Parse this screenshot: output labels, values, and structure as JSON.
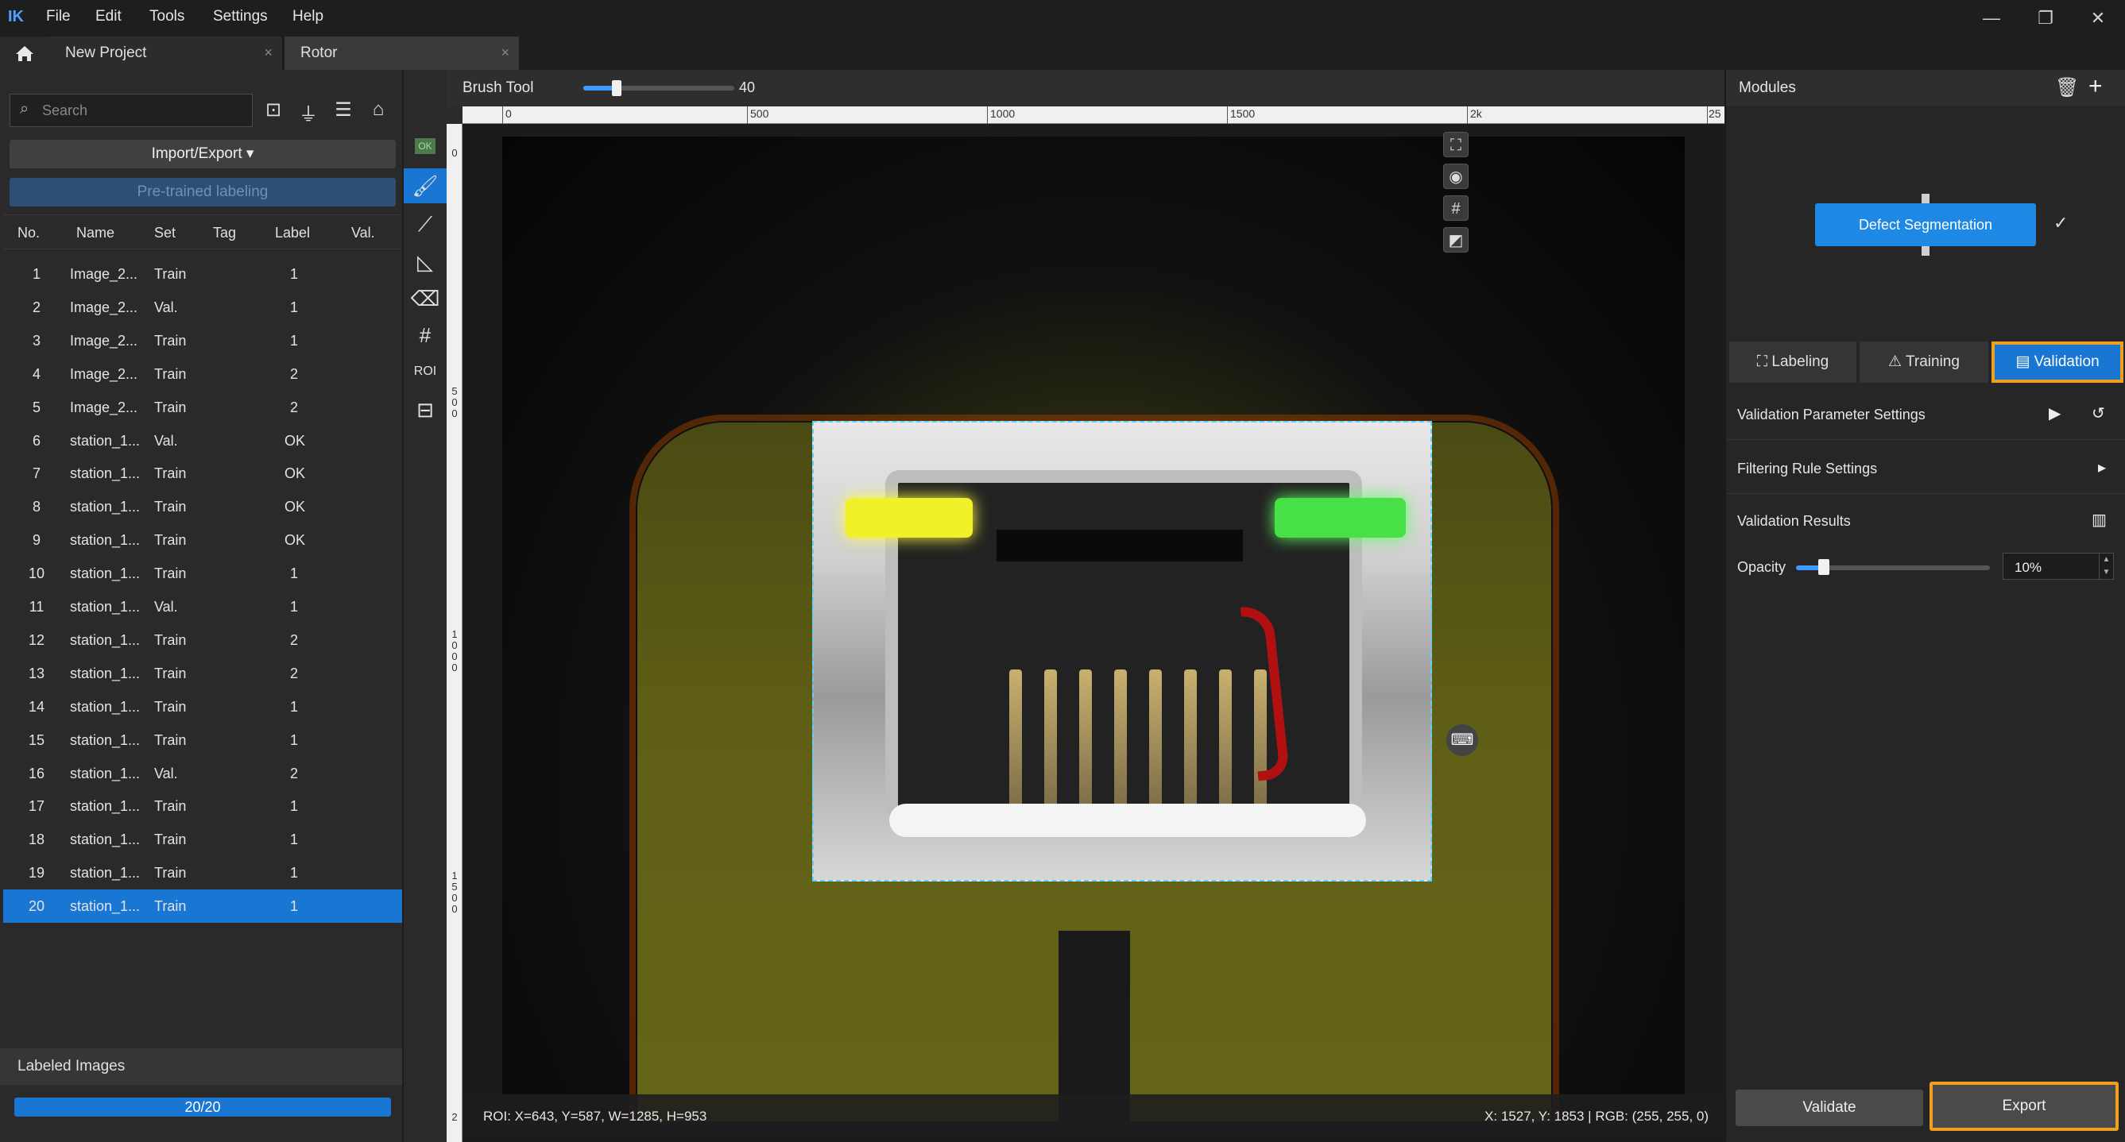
{
  "app": {
    "menu": [
      "File",
      "Edit",
      "Tools",
      "Settings",
      "Help"
    ],
    "logo_text": "IK"
  },
  "tabs": [
    {
      "label": "New Project"
    },
    {
      "label": "Rotor"
    }
  ],
  "left": {
    "search_placeholder": "Search",
    "import_export": "Import/Export ▾",
    "pretrained": "Pre-trained labeling",
    "columns": [
      "No.",
      "Name",
      "Set",
      "Tag",
      "Label",
      "Val."
    ],
    "rows": [
      {
        "no": "1",
        "name": "Image_2...",
        "set": "Train",
        "label": "1"
      },
      {
        "no": "2",
        "name": "Image_2...",
        "set": "Val.",
        "label": "1"
      },
      {
        "no": "3",
        "name": "Image_2...",
        "set": "Train",
        "label": "1"
      },
      {
        "no": "4",
        "name": "Image_2...",
        "set": "Train",
        "label": "2"
      },
      {
        "no": "5",
        "name": "Image_2...",
        "set": "Train",
        "label": "2"
      },
      {
        "no": "6",
        "name": "station_1...",
        "set": "Val.",
        "label": "OK"
      },
      {
        "no": "7",
        "name": "station_1...",
        "set": "Train",
        "label": "OK"
      },
      {
        "no": "8",
        "name": "station_1...",
        "set": "Train",
        "label": "OK"
      },
      {
        "no": "9",
        "name": "station_1...",
        "set": "Train",
        "label": "OK"
      },
      {
        "no": "10",
        "name": "station_1...",
        "set": "Train",
        "label": "1"
      },
      {
        "no": "11",
        "name": "station_1...",
        "set": "Val.",
        "label": "1"
      },
      {
        "no": "12",
        "name": "station_1...",
        "set": "Train",
        "label": "2"
      },
      {
        "no": "13",
        "name": "station_1...",
        "set": "Train",
        "label": "2"
      },
      {
        "no": "14",
        "name": "station_1...",
        "set": "Train",
        "label": "1"
      },
      {
        "no": "15",
        "name": "station_1...",
        "set": "Train",
        "label": "1"
      },
      {
        "no": "16",
        "name": "station_1...",
        "set": "Val.",
        "label": "2"
      },
      {
        "no": "17",
        "name": "station_1...",
        "set": "Train",
        "label": "1"
      },
      {
        "no": "18",
        "name": "station_1...",
        "set": "Train",
        "label": "1"
      },
      {
        "no": "19",
        "name": "station_1...",
        "set": "Train",
        "label": "1"
      },
      {
        "no": "20",
        "name": "station_1...",
        "set": "Train",
        "label": "1"
      }
    ],
    "selected_row": "20",
    "labeled_images": "Labeled Images",
    "progress_text": "20/20"
  },
  "tools": {
    "ok_badge": "OK",
    "roi_label": "ROI"
  },
  "canvas": {
    "brush_label": "Brush Tool",
    "brush_value": "40",
    "ruler_marks": [
      "0",
      "500",
      "1000",
      "1500",
      "2k",
      "25"
    ],
    "vruler_marks": [
      "0",
      "5\n0\n0",
      "1\n0\n0\n0",
      "1\n5\n0\n0",
      "2"
    ],
    "roi_status": "ROI: X=643, Y=587, W=1285, H=953",
    "coord_status": "X: 1527, Y: 1853 | RGB: (255, 255, 0)"
  },
  "right": {
    "modules_title": "Modules",
    "node_label": "Defect Segmentation",
    "tabs": [
      "Labeling",
      "Training",
      "Validation"
    ],
    "active_tab": "Validation",
    "sections": [
      "Validation Parameter Settings",
      "Filtering Rule Settings",
      "Validation Results"
    ],
    "opacity_label": "Opacity",
    "opacity_value": "10%",
    "validate_btn": "Validate",
    "export_btn": "Export"
  }
}
